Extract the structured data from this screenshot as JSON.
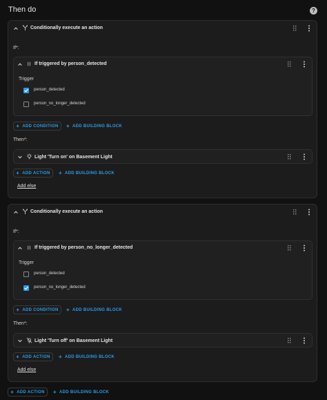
{
  "header": {
    "title": "Then do"
  },
  "blocks": [
    {
      "title": "Conditionally execute an action",
      "if_label": "If*:",
      "condition": {
        "title": "If triggered by person_detected",
        "trigger_label": "Trigger",
        "options": [
          {
            "label": "person_detected",
            "checked": true
          },
          {
            "label": "person_no_longer_detected",
            "checked": false
          }
        ]
      },
      "add_condition": "ADD CONDITION",
      "add_building_block_1": "ADD BUILDING BLOCK",
      "then_label": "Then*:",
      "action": {
        "title": "Light 'Turn on' on Basement Light"
      },
      "add_action": "ADD ACTION",
      "add_building_block_2": "ADD BUILDING BLOCK",
      "add_else": "Add else"
    },
    {
      "title": "Conditionally execute an action",
      "if_label": "If*:",
      "condition": {
        "title": "If triggered by person_no_longer_detected",
        "trigger_label": "Trigger",
        "options": [
          {
            "label": "person_detected",
            "checked": false
          },
          {
            "label": "person_no_longer_detected",
            "checked": true
          }
        ]
      },
      "add_condition": "ADD CONDITION",
      "add_building_block_1": "ADD BUILDING BLOCK",
      "then_label": "Then*:",
      "action": {
        "title": "Light 'Turn off' on Basement Light"
      },
      "add_action": "ADD ACTION",
      "add_building_block_2": "ADD BUILDING BLOCK",
      "add_else": "Add else"
    }
  ],
  "footer": {
    "add_action": "ADD ACTION",
    "add_building_block": "ADD BUILDING BLOCK"
  },
  "colors": {
    "accent": "#2a9ce8",
    "background": "#111111",
    "card": "#1c1c1c"
  }
}
